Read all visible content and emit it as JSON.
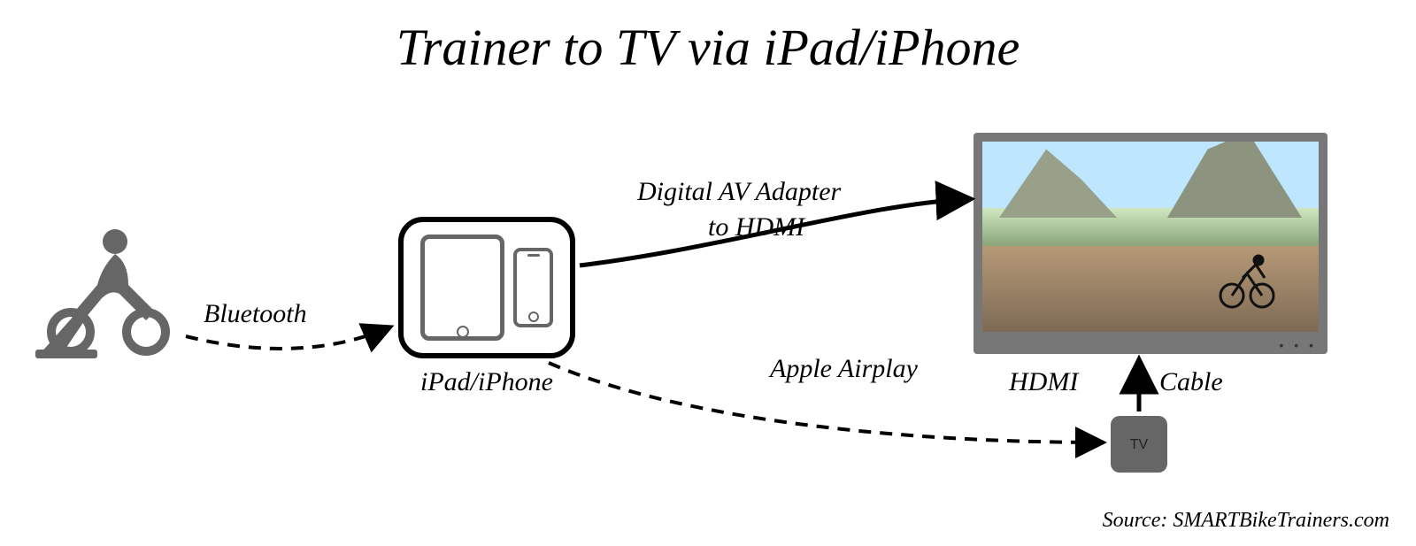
{
  "title": "Trainer to TV via iPad/iPhone",
  "labels": {
    "bluetooth": "Bluetooth",
    "device": "iPad/iPhone",
    "av_adapter_line1": "Digital AV Adapter",
    "av_adapter_line2": "to HDMI",
    "airplay": "Apple Airplay",
    "hdmi_left": "HDMI",
    "hdmi_right": "Cable",
    "appletv": "TV"
  },
  "source": "Source: SMARTBikeTrainers.com",
  "nodes": {
    "trainer": "bike-trainer",
    "device": "ipad-iphone",
    "tv": "television",
    "appletv": "apple-tv"
  },
  "connections": [
    {
      "from": "trainer",
      "to": "device",
      "label": "Bluetooth",
      "style": "dashed"
    },
    {
      "from": "device",
      "to": "tv",
      "label": "Digital AV Adapter to HDMI",
      "style": "solid"
    },
    {
      "from": "device",
      "to": "appletv",
      "label": "Apple Airplay",
      "style": "dashed"
    },
    {
      "from": "appletv",
      "to": "tv",
      "label": "HDMI Cable",
      "style": "solid"
    }
  ]
}
